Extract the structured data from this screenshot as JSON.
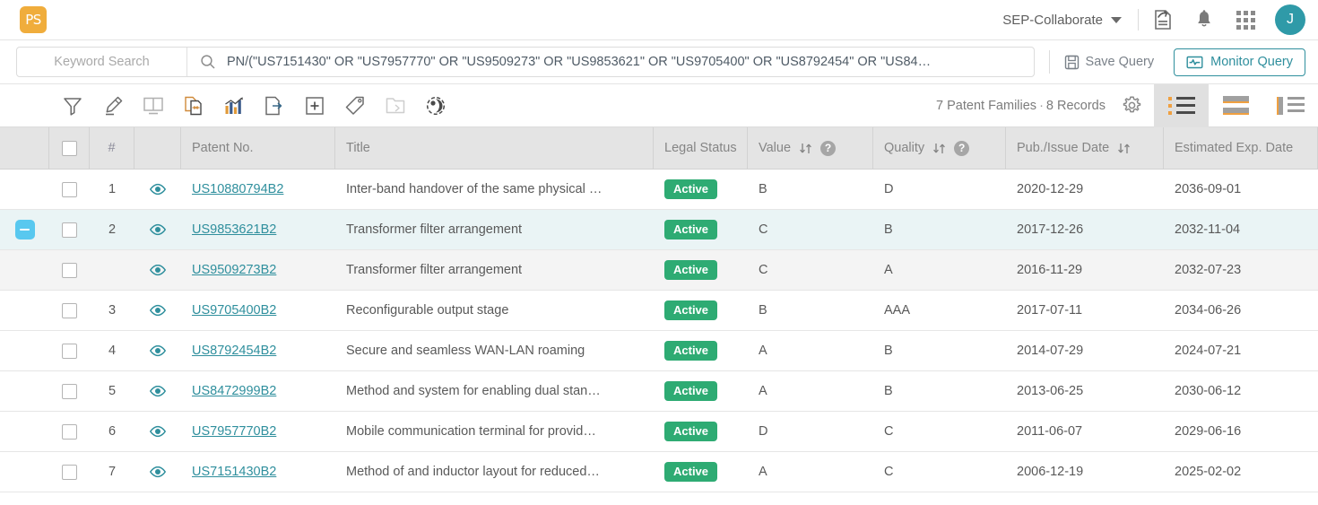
{
  "app": {
    "logo_text": "PS",
    "logo_color": "#f0ad3c",
    "accent_teal": "#2f8f9d",
    "badge_green": "#2eab73"
  },
  "header": {
    "workspace": "SEP-Collaborate",
    "icons": [
      "document-upload-icon",
      "bell-icon",
      "apps-grid-icon"
    ],
    "avatar_initial": "J"
  },
  "search": {
    "keyword_placeholder": "Keyword Search",
    "query_value": "PN/(\"US7151430\" OR \"US7957770\" OR \"US9509273\" OR \"US9853621\" OR \"US9705400\" OR \"US8792454\" OR \"US84…",
    "save_label": "Save Query",
    "monitor_label": "Monitor Query"
  },
  "toolbar": {
    "tools": [
      {
        "name": "filter-icon",
        "disabled": false
      },
      {
        "name": "highlighter-icon",
        "disabled": false
      },
      {
        "name": "split-view-icon",
        "disabled": false
      },
      {
        "name": "merge-documents-icon",
        "disabled": false
      },
      {
        "name": "analytics-chart-icon",
        "disabled": false
      },
      {
        "name": "export-icon",
        "disabled": false
      },
      {
        "name": "add-icon",
        "disabled": false
      },
      {
        "name": "tag-icon",
        "disabled": false
      },
      {
        "name": "move-to-folder-icon",
        "disabled": true
      },
      {
        "name": "share-globe-icon",
        "disabled": false
      }
    ],
    "families_count": "7 Patent Families",
    "records_count": "8 Records",
    "separator": "·",
    "settings_icon": "gear-icon",
    "view_modes": [
      {
        "name": "list-view",
        "active": true
      },
      {
        "name": "card-view",
        "active": false
      },
      {
        "name": "split-view",
        "active": false
      }
    ]
  },
  "table": {
    "columns": [
      {
        "key": "num",
        "label": "#"
      },
      {
        "key": "patent",
        "label": "Patent No."
      },
      {
        "key": "title",
        "label": "Title"
      },
      {
        "key": "legal",
        "label": "Legal Status"
      },
      {
        "key": "value",
        "label": "Value",
        "sortable": true,
        "help": true
      },
      {
        "key": "quality",
        "label": "Quality",
        "sortable": true,
        "help": true
      },
      {
        "key": "pub",
        "label": "Pub./Issue Date",
        "sortable": true
      },
      {
        "key": "exp",
        "label": "Estimated Exp. Date"
      }
    ],
    "rows": [
      {
        "num": "1",
        "patent": "US10880794B2",
        "title": "Inter-band handover of the same physical …",
        "legal": "Active",
        "value": "B",
        "quality": "D",
        "pub": "2020-12-29",
        "exp": "2036-09-01",
        "state": "normal",
        "expandable": false,
        "child": false
      },
      {
        "num": "2",
        "patent": "US9853621B2",
        "title": "Transformer filter arrangement",
        "legal": "Active",
        "value": "C",
        "quality": "B",
        "pub": "2017-12-26",
        "exp": "2032-11-04",
        "state": "selected",
        "expandable": true,
        "child": false
      },
      {
        "num": "",
        "patent": "US9509273B2",
        "title": "Transformer filter arrangement",
        "legal": "Active",
        "value": "C",
        "quality": "A",
        "pub": "2016-11-29",
        "exp": "2032-07-23",
        "state": "child",
        "expandable": false,
        "child": true
      },
      {
        "num": "3",
        "patent": "US9705400B2",
        "title": "Reconfigurable output stage",
        "legal": "Active",
        "value": "B",
        "quality": "AAA",
        "pub": "2017-07-11",
        "exp": "2034-06-26",
        "state": "normal",
        "expandable": false,
        "child": false
      },
      {
        "num": "4",
        "patent": "US8792454B2",
        "title": "Secure and seamless WAN-LAN roaming",
        "legal": "Active",
        "value": "A",
        "quality": "B",
        "pub": "2014-07-29",
        "exp": "2024-07-21",
        "state": "normal",
        "expandable": false,
        "child": false
      },
      {
        "num": "5",
        "patent": "US8472999B2",
        "title": "Method and system for enabling dual stan…",
        "legal": "Active",
        "value": "A",
        "quality": "B",
        "pub": "2013-06-25",
        "exp": "2030-06-12",
        "state": "normal",
        "expandable": false,
        "child": false
      },
      {
        "num": "6",
        "patent": "US7957770B2",
        "title": "Mobile communication terminal for provid…",
        "legal": "Active",
        "value": "D",
        "quality": "C",
        "pub": "2011-06-07",
        "exp": "2029-06-16",
        "state": "normal",
        "expandable": false,
        "child": false
      },
      {
        "num": "7",
        "patent": "US7151430B2",
        "title": "Method of and inductor layout for reduced…",
        "legal": "Active",
        "value": "A",
        "quality": "C",
        "pub": "2006-12-19",
        "exp": "2025-02-02",
        "state": "normal",
        "expandable": false,
        "child": false
      }
    ]
  }
}
